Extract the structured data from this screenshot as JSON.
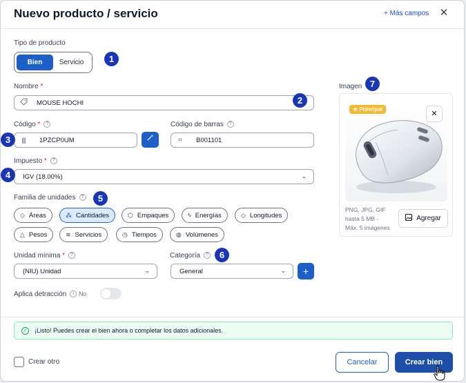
{
  "header": {
    "title": "Nuevo producto / servicio",
    "more_fields": "+ Más campos",
    "close_icon": "close-icon"
  },
  "product_type": {
    "label": "Tipo de producto",
    "options": [
      "Bien",
      "Servicio"
    ],
    "selected": "Bien"
  },
  "name": {
    "label": "Nombre",
    "value": "MOUSE HOCHI"
  },
  "code": {
    "label": "Código",
    "value": "1PZCP0UM"
  },
  "barcode": {
    "label": "Código de barras",
    "value": "B001101"
  },
  "tax": {
    "label": "Impuesto",
    "value": "IGV (18.00%)"
  },
  "units_family": {
    "label": "Familia de unidades",
    "chips": [
      "Áreas",
      "Cantidades",
      "Empaques",
      "Energías",
      "Longitudes",
      "Pesos",
      "Servicios",
      "Tiempos",
      "Volúmenes"
    ],
    "selected": "Cantidades"
  },
  "min_unit": {
    "label": "Unidad mínima",
    "value": "(NIU) Unidad"
  },
  "category": {
    "label": "Categoría",
    "value": "General"
  },
  "detraction": {
    "label": "Aplica detracción",
    "state_label": "No",
    "enabled": false
  },
  "image": {
    "label": "Imagen",
    "principal": "Principal",
    "note_lines": [
      "PNG, JPG, GIF",
      "hasta 5 MB -",
      "Máx. 5 imágenes"
    ],
    "add_label": "Agregar"
  },
  "alert": {
    "text": "¡Listo! Puedes crear el bien ahora o completar los datos adicionales."
  },
  "footer": {
    "create_another": "Crear otro",
    "cancel": "Cancelar",
    "create": "Crear bien"
  },
  "badges": [
    "1",
    "2",
    "3",
    "4",
    "5",
    "6",
    "7"
  ],
  "colors": {
    "primary": "#1d5fc9",
    "badge": "#1936b8",
    "alert_bg": "#ecfdf5",
    "principal": "#f5b82e"
  }
}
